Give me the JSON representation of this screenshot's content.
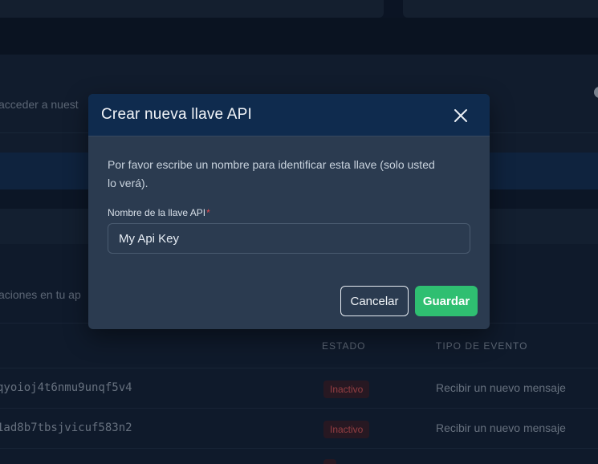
{
  "background": {
    "intro_text": "acceder a nuest",
    "section_text": "aciones en tu ap",
    "table": {
      "headers": {
        "status": "ESTADO",
        "event_type": "TIPO DE EVENTO"
      },
      "rows": [
        {
          "key": "qyoioj4t6nmu9unqf5v4",
          "status": "Inactivo",
          "event_type": "Recibir un nuevo mensaje"
        },
        {
          "key": "1ad8b7tbsjvicuf583n2",
          "status": "Inactivo",
          "event_type": "Recibir un nuevo mensaje"
        }
      ]
    }
  },
  "modal": {
    "title": "Crear nueva llave API",
    "close_icon": "close-icon",
    "description": "Por favor escribe un nombre para identificar esta llave (solo usted lo verá).",
    "field": {
      "label": "Nombre de la llave API",
      "required_mark": "*",
      "value": "My Api Key"
    },
    "buttons": {
      "cancel": "Cancelar",
      "save": "Guardar"
    }
  },
  "colors": {
    "primary_action": "#2fbf71",
    "header": "#0f2b4e",
    "required": "#e5484d",
    "inactive_badge": "#e05a5a"
  }
}
